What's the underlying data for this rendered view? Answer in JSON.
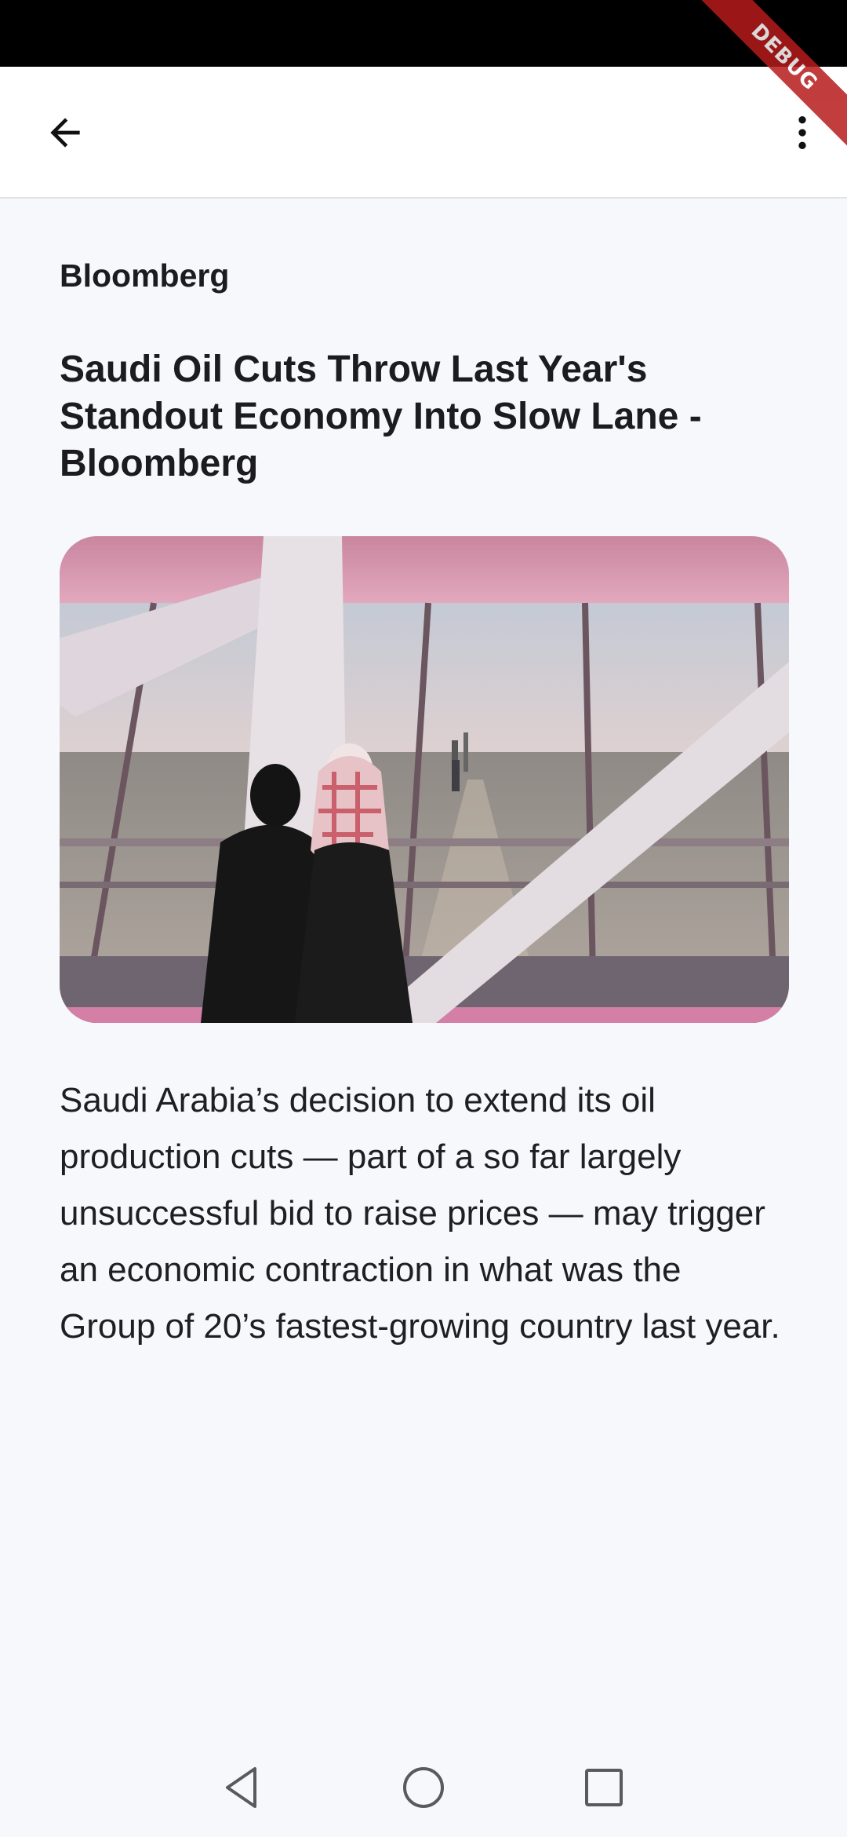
{
  "debug_banner": "DEBUG",
  "app_bar": {
    "back_icon": "arrow-back-icon",
    "menu_icon": "more-vert-icon"
  },
  "article": {
    "source": "Bloomberg",
    "title": "Saudi Oil Cuts Throw Last Year's Standout Economy Into Slow Lane - Bloomberg",
    "image": "observation-deck-photo",
    "description": "Saudi Arabia’s decision to extend its oil production cuts — part of a so far largely unsuccessful bid to raise prices — may trigger an economic contraction in what was the Group of 20’s fastest-growing country last year."
  },
  "nav_bar": {
    "back_icon": "nav-back-triangle-icon",
    "home_icon": "nav-home-circle-icon",
    "recent_icon": "nav-recent-square-icon"
  },
  "colors": {
    "status_bar": "#000000",
    "app_bar": "#ffffff",
    "background": "#f7f8fb",
    "debug": "#b71c1c",
    "text": "#1c1c1e"
  }
}
